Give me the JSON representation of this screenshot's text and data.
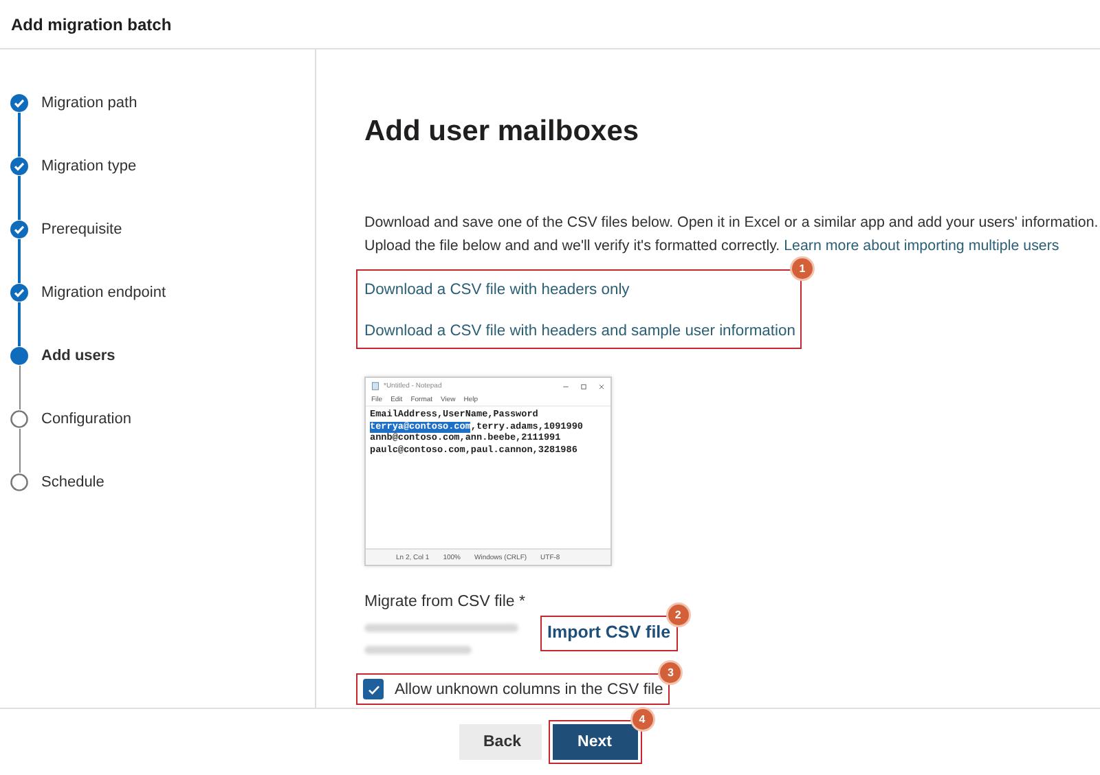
{
  "window": {
    "title": "Add migration batch"
  },
  "steps": [
    {
      "label": "Migration path",
      "kind": "done"
    },
    {
      "label": "Migration type",
      "kind": "done"
    },
    {
      "label": "Prerequisite",
      "kind": "done"
    },
    {
      "label": "Migration endpoint",
      "kind": "done"
    },
    {
      "label": "Add users",
      "kind": "current"
    },
    {
      "label": "Configuration",
      "kind": "pending"
    },
    {
      "label": "Schedule",
      "kind": "pending"
    }
  ],
  "page": {
    "heading": "Add user mailboxes",
    "intro_line_1": "Download and save one of the CSV files below. Open it in Excel or a similar app and add your users' information.",
    "intro_line_2": "Upload the file below and and we'll verify it's formatted correctly.",
    "learn_more_link": "Learn more about importing multiple users"
  },
  "downloads": {
    "callout": "1",
    "links": [
      "Download a CSV file with headers only",
      "Download a CSV file with headers and sample user information"
    ]
  },
  "notepad": {
    "title": "*Untitled - Notepad",
    "menu": [
      "File",
      "Edit",
      "Format",
      "View",
      "Help"
    ],
    "lines": [
      [
        {
          "text": "EmailAddress,UserName,Password",
          "selected": false
        }
      ],
      [
        {
          "text": "terrya@contoso.com",
          "selected": true
        },
        {
          "text": ",terry.adams,1091990",
          "selected": false
        }
      ],
      [
        {
          "text": "annb@contoso.com,ann.beebe,2111991",
          "selected": false
        }
      ],
      [
        {
          "text": "paulc@contoso.com,paul.cannon,3281986",
          "selected": false
        }
      ]
    ],
    "status": [
      "Ln 2, Col 1",
      "100%",
      "Windows (CRLF)",
      "UTF-8"
    ]
  },
  "csv_import": {
    "label": "Migrate from CSV file *",
    "button": "Import CSV file",
    "callout": "2"
  },
  "allow_unknown": {
    "label": "Allow unknown columns in the CSV file",
    "checked": true,
    "callout": "3"
  },
  "footer": {
    "buttons": [
      {
        "label": "Back",
        "kind": "secondary"
      },
      {
        "label": "Next",
        "kind": "primary",
        "callout": "4"
      }
    ]
  }
}
